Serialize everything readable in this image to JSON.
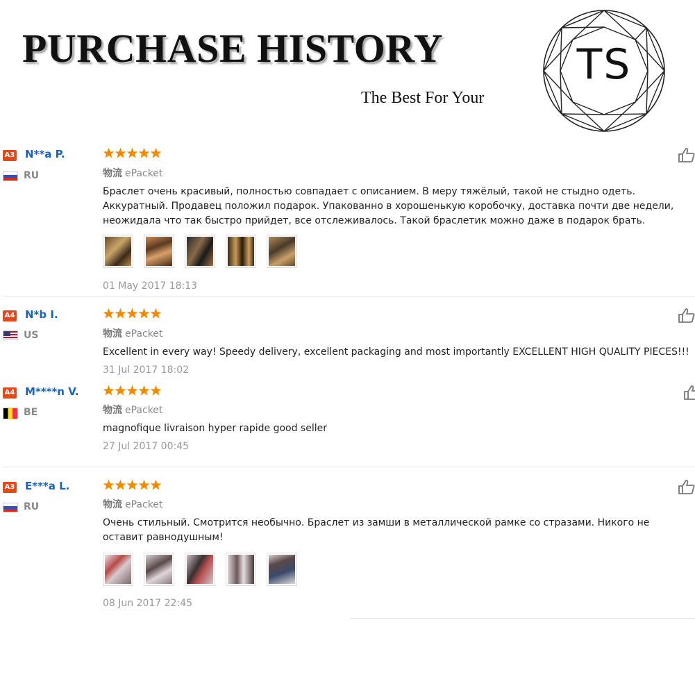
{
  "header": {
    "title": "PURCHASE HISTORY",
    "tagline": "The Best For Your",
    "logo_text": "TS"
  },
  "reviews": [
    {
      "badge": "A3",
      "name": "N**a P.",
      "country": "RU",
      "flag": "flag-russia",
      "rating": 5,
      "logistics_label": "物流",
      "logistics_value": "ePacket",
      "comment": "Браслет очень красивый, полностью совпадает с описанием. В меру тяжёлый, такой не стыдно одеть. Аккуратный. Продавец положил подарок. Упакованно в хорошенькую коробочку, доставка почти две недели, неожидала что так быстро прийдет, все отслеживалось. Такой браслетик можно даже в подарок брать.",
      "photos": [
        "bracelet-photo-1",
        "bracelet-photo-2",
        "bracelet-photo-3",
        "bracelet-photo-4",
        "bracelet-photo-5"
      ],
      "date": "01 May 2017 18:13"
    },
    {
      "badge": "A4",
      "name": "N*b I.",
      "country": "US",
      "flag": "flag-usa",
      "rating": 5,
      "logistics_label": "物流",
      "logistics_value": "ePacket",
      "comment": "Excellent in every way! Speedy delivery, excellent packaging and most importantly EXCELLENT HIGH QUALITY PIECES!!!",
      "photos": [],
      "date": "31 Jul 2017 18:02"
    },
    {
      "badge": "A4",
      "name": "M****n V.",
      "country": "BE",
      "flag": "flag-belgium",
      "rating": 5,
      "logistics_label": "物流",
      "logistics_value": "ePacket",
      "comment": "magnofique livraison hyper rapide good seller",
      "photos": [],
      "date": "27 Jul 2017 00:45"
    },
    {
      "badge": "A3",
      "name": "E***a L.",
      "country": "RU",
      "flag": "flag-russia",
      "rating": 5,
      "logistics_label": "物流",
      "logistics_value": "ePacket",
      "comment": "Очень стильный. Смотрится необычно. Браслет из замши в металлической рамке со стразами. Никого не оставит равнодушным!",
      "photos": [
        "wrist-photo-1",
        "wrist-photo-2",
        "wrist-photo-3",
        "wrist-photo-4",
        "wrist-photo-5"
      ],
      "date": "08 Jun 2017 22:45"
    }
  ],
  "colors": {
    "star": "#f08a00",
    "name": "#1a63b5",
    "badge": "#e24a1d"
  },
  "icons": {
    "star": "star-icon",
    "like": "thumbs-up-icon"
  }
}
